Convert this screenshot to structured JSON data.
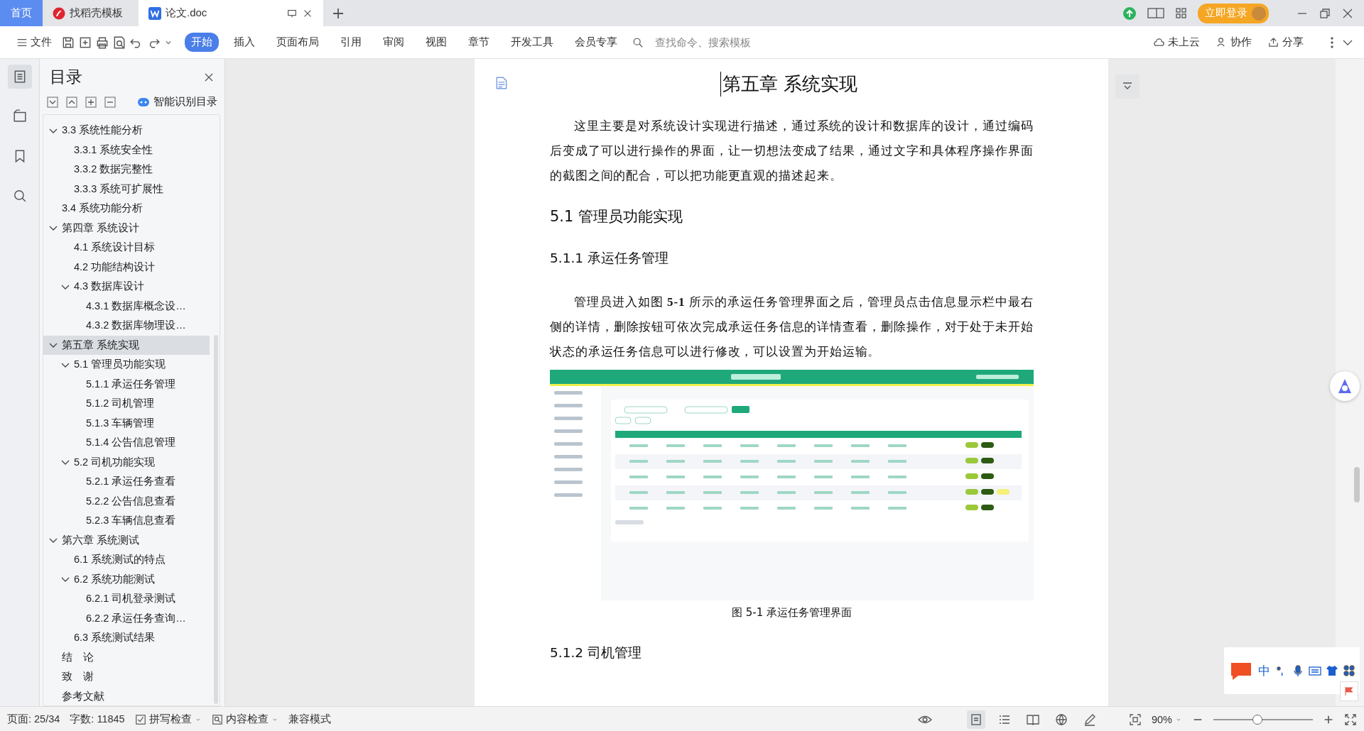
{
  "tabs": [
    {
      "label": "首页",
      "kind": "home",
      "selected": false
    },
    {
      "label": "找稻壳模板",
      "kind": "template",
      "selected": false
    },
    {
      "label": "论文.doc",
      "kind": "doc",
      "selected": true
    }
  ],
  "account": {
    "login": "立即登录"
  },
  "toolbar": {
    "file": "文件",
    "menus": [
      {
        "label": "开始",
        "selected": true
      },
      {
        "label": "插入",
        "selected": false
      },
      {
        "label": "页面布局",
        "selected": false
      },
      {
        "label": "引用",
        "selected": false
      },
      {
        "label": "审阅",
        "selected": false
      },
      {
        "label": "视图",
        "selected": false
      },
      {
        "label": "章节",
        "selected": false
      },
      {
        "label": "开发工具",
        "selected": false
      },
      {
        "label": "会员专享",
        "selected": false
      }
    ],
    "search": {
      "placeholder": "查找命令、搜索模板"
    },
    "actions": [
      {
        "label": "未上云",
        "kind": "cloud"
      },
      {
        "label": "协作",
        "kind": "people"
      },
      {
        "label": "分享",
        "kind": "share"
      }
    ]
  },
  "toc": {
    "title": "目录",
    "smart_button": "智能识别目录",
    "items": [
      {
        "children": [
          {
            "label": "3.3 系统性能分析",
            "selected": false,
            "expanded": true,
            "children": [
              {
                "label": "3.3.1 系统安全性",
                "selected": false
              },
              {
                "label": "3.3.2 数据完整性",
                "selected": false
              },
              {
                "label": "3.3.3 系统可扩展性",
                "selected": false
              }
            ]
          },
          {
            "label": "3.4 系统功能分析",
            "selected": false
          }
        ]
      },
      {
        "label": "第四章  系统设计",
        "selected": false,
        "expanded": true,
        "children": [
          {
            "label": "4.1  系统设计目标",
            "selected": false
          },
          {
            "label": "4.2 功能结构设计",
            "selected": false
          },
          {
            "label": "4.3 数据库设计",
            "selected": false,
            "expanded": true,
            "children": [
              {
                "label": "4.3.1  数据库概念设…",
                "selected": false
              },
              {
                "label": "4.3.2  数据库物理设…",
                "selected": false
              }
            ]
          }
        ]
      },
      {
        "label": "第五章  系统实现",
        "selected": true,
        "expanded": true,
        "children": [
          {
            "label": "5.1 管理员功能实现",
            "selected": false,
            "expanded": true,
            "children": [
              {
                "label": "5.1.1  承运任务管理",
                "selected": false
              },
              {
                "label": "5.1.2  司机管理",
                "selected": false
              },
              {
                "label": "5.1.3  车辆管理",
                "selected": false
              },
              {
                "label": "5.1.4  公告信息管理",
                "selected": false
              }
            ]
          },
          {
            "label": "5.2 司机功能实现",
            "selected": false,
            "expanded": true,
            "children": [
              {
                "label": "5.2.1  承运任务查看",
                "selected": false
              },
              {
                "label": "5.2.2  公告信息查看",
                "selected": false
              },
              {
                "label": "5.2.3  车辆信息查看",
                "selected": false
              }
            ]
          }
        ]
      },
      {
        "label": "第六章  系统测试",
        "selected": false,
        "expanded": true,
        "children": [
          {
            "label": "6.1 系统测试的特点",
            "selected": false
          },
          {
            "label": "6.2  系统功能测试",
            "selected": false,
            "expanded": true,
            "children": [
              {
                "label": "6.2.1  司机登录测试",
                "selected": false
              },
              {
                "label": "6.2.2  承运任务查询…",
                "selected": false
              }
            ]
          },
          {
            "label": "6.3  系统测试结果",
            "selected": false
          }
        ]
      },
      {
        "label": "结　论",
        "selected": false
      },
      {
        "label": "致　谢",
        "selected": false
      },
      {
        "label": "参考文献",
        "selected": false
      }
    ]
  },
  "document": {
    "blocks": [
      {
        "kind": "chapter",
        "text": "第五章  系统实现"
      },
      {
        "kind": "paragraph",
        "text": "这里主要是对系统设计实现进行描述，通过系统的设计和数据库的设计，通过编码后变成了可以进行操作的界面，让一切想法变成了结果，通过文字和具体程序操作界面的截图之间的配合，可以把功能更直观的描述起来。"
      },
      {
        "kind": "section",
        "text": "5.1 管理员功能实现"
      },
      {
        "kind": "subsection",
        "text": "5.1.1  承运任务管理"
      },
      {
        "kind": "paragraph",
        "text": "管理员进入如图 **5-1** 所示的承运任务管理界面之后，管理员点击信息显示栏中最右侧的详情，删除按钮可依次完成承运任务信息的详情查看，删除操作，对于处于未开始状态的承运任务信息可以进行修改，可以设置为开始运输。"
      },
      {
        "kind": "figure"
      },
      {
        "kind": "caption",
        "text": "图 5-1  承运任务管理界面"
      },
      {
        "kind": "subsection",
        "text": "5.1.2  司机管理"
      }
    ]
  },
  "ime": {
    "mode": "中"
  },
  "status_bar": {
    "page": "页面: 25/34",
    "words": "字数: 11845",
    "spell": "拼写检查",
    "content": "内容检查",
    "compat": "兼容模式",
    "zoom": "90%",
    "zoom_slider": {
      "level": 0.44
    }
  }
}
